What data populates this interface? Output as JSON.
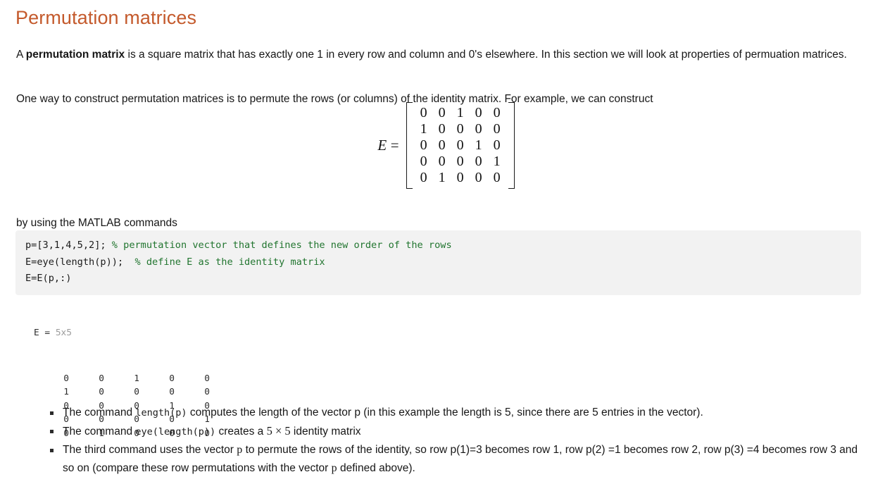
{
  "document": {
    "title": "Permutation matrices",
    "title_color": "#c45a2c",
    "body_color": "#161616",
    "background": "#ffffff"
  },
  "paragraphs": {
    "p1_lead": "A ",
    "p1_bold": "permutation matrix",
    "p1_rest": " is a square matrix that has exactly one 1 in every row and column and 0's elsewhere. In this section we will look at properties of permuation matrices.",
    "p2": "One way to construct permutation matrices is to permute the rows (or columns) of the identity matrix. For example, we can construct",
    "p3": "by using the MATLAB commands"
  },
  "equation": {
    "lhs": "E",
    "equals": "=",
    "rows": [
      [
        "0",
        "0",
        "1",
        "0",
        "0"
      ],
      [
        "1",
        "0",
        "0",
        "0",
        "0"
      ],
      [
        "0",
        "0",
        "0",
        "1",
        "0"
      ],
      [
        "0",
        "0",
        "0",
        "0",
        "1"
      ],
      [
        "0",
        "1",
        "0",
        "0",
        "0"
      ]
    ]
  },
  "code_block": {
    "background": "#f2f2f2",
    "comment_color": "#21752f",
    "line1_code": "p=[3,1,4,5,2]; ",
    "line1_comment": "% permutation vector that defines the new order of the rows",
    "line2_code": "E=eye(length(p));  ",
    "line2_comment": "% define E as the identity matrix",
    "line3_code": "E=E(p,:)"
  },
  "console_output": {
    "var_name": "E = ",
    "var_size": "5x5",
    "rows": [
      [
        "0",
        "0",
        "1",
        "0",
        "0"
      ],
      [
        "1",
        "0",
        "0",
        "0",
        "0"
      ],
      [
        "0",
        "0",
        "0",
        "1",
        "0"
      ],
      [
        "0",
        "0",
        "0",
        "0",
        "1"
      ],
      [
        "0",
        "1",
        "0",
        "0",
        "0"
      ]
    ]
  },
  "bullets": [
    {
      "seg1": "The command ",
      "code1": "length(p)",
      "seg2": "  computes the length of the vector p (in this example the length is 5, since there are 5 entries in the vector)."
    },
    {
      "seg1": "The command ",
      "code1": "eye(length(p))",
      "seg2": " creates a ",
      "math": "5 × 5",
      "seg3": " identity matrix"
    },
    {
      "seg1": "The third command uses the vector ",
      "var1": "p",
      "seg2": " to permute the rows of the identity, so row p(1)=3 becomes row 1, row p(2) =1 becomes row 2, row p(3) =4 becomes row 3 and so on (compare these row permutations with the vector ",
      "var2": "p",
      "seg3": "  defined above)."
    }
  ]
}
